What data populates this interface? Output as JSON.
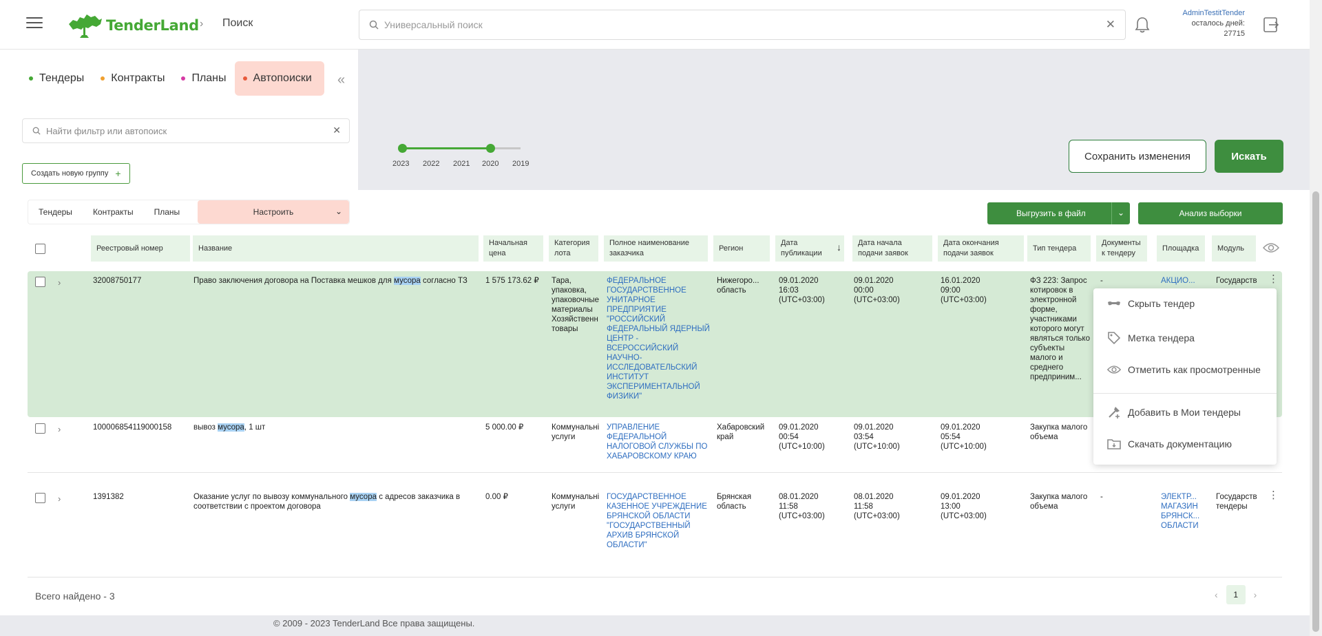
{
  "header": {
    "logo_text": "TenderLand",
    "breadcrumb": "Поиск",
    "search_placeholder": "Универсальный поиск",
    "user_name": "AdminTestitTender",
    "days_left_label": "осталось дней:",
    "days_left_value": "27715"
  },
  "left_panel": {
    "tabs": [
      {
        "label": "Тендеры",
        "dot_color": "#45a835"
      },
      {
        "label": "Контракты",
        "dot_color": "#f0a030"
      },
      {
        "label": "Планы",
        "dot_color": "#d63aa5"
      },
      {
        "label": "Автопоиски",
        "dot_color": "#e85a3c",
        "active": true
      }
    ],
    "filter_search_placeholder": "Найти фильтр или автопоиск",
    "new_group_label": "Создать новую группу"
  },
  "year_slider": {
    "years": [
      "2023",
      "2022",
      "2021",
      "2020",
      "2019"
    ],
    "selected_range": [
      "2023",
      "2020"
    ]
  },
  "actions": {
    "save_label": "Сохранить изменения",
    "search_label": "Искать"
  },
  "results": {
    "subtabs": [
      "Тендеры",
      "Контракты",
      "Планы"
    ],
    "configure_label": "Настроить",
    "export_label": "Выгрузить в файл",
    "analysis_label": "Анализ выборки",
    "columns": [
      "Реестровый номер",
      "Название",
      "Начальная цена",
      "Категория лота",
      "Полное наименование заказчика",
      "Регион",
      "Дата публикации",
      "Дата начала подачи заявок",
      "Дата окончания подачи заявок",
      "Тип тендера",
      "Документы к тендеру",
      "Площадка",
      "Модуль"
    ],
    "rows": [
      {
        "reg": "32008750177",
        "name_pre": "Право заключения договора на Поставка мешков для ",
        "name_hl": "мусора",
        "name_post": " согласно ТЗ",
        "price": "1 575 173.62 ₽",
        "category": "Тара, упаковка, упаковочные материалы Хозяйственн товары",
        "customer": "ФЕДЕРАЛЬНОЕ ГОСУДАРСТВЕННОЕ УНИТАРНОЕ ПРЕДПРИЯТИЕ \"РОССИЙСКИЙ ФЕДЕРАЛЬНЫЙ ЯДЕРНЫЙ ЦЕНТР - ВСЕРОССИЙСКИЙ НАУЧНО-ИССЛЕДОВАТЕЛЬСКИЙ ИНСТИТУТ ЭКСПЕРИМЕНТАЛЬНОЙ ФИЗИКИ\"",
        "region": "Нижегоро... область",
        "pub": "09.01.2020 16:03 (UTC+03:00)",
        "start": "09.01.2020 00:00 (UTC+03:00)",
        "end": "16.01.2020 09:00 (UTC+03:00)",
        "type": "ФЗ 223: Запрос котировок в электронной форме, участниками которого могут являться только субъекты малого и среднего предприним...",
        "docs": "-",
        "platform": "АКЦИО...",
        "module": "Государств"
      },
      {
        "reg": "100006854119000158",
        "name_pre": "вывоз ",
        "name_hl": "мусора",
        "name_post": ", 1 шт",
        "price": "5 000.00 ₽",
        "category": "Коммунальні услуги",
        "customer": "УПРАВЛЕНИЕ ФЕДЕРАЛЬНОЙ НАЛОГОВОЙ СЛУЖБЫ ПО ХАБАРОВСКОМУ КРАЮ",
        "region": "Хабаровский край",
        "pub": "09.01.2020 00:54 (UTC+10:00)",
        "start": "09.01.2020 03:54 (UTC+10:00)",
        "end": "09.01.2020 05:54 (UTC+10:00)",
        "type": "Закупка малого объема",
        "docs": "",
        "platform": "",
        "module": ""
      },
      {
        "reg": "1391382",
        "name_pre": "Оказание услуг по вывозу коммунального ",
        "name_hl": "мусора",
        "name_post": " с адресов заказчика в соответствии с проектом договора",
        "price": "0.00 ₽",
        "category": "Коммунальні услуги",
        "customer": "ГОСУДАРСТВЕННОЕ КАЗЕННОЕ УЧРЕЖДЕНИЕ БРЯНСКОЙ ОБЛАСТИ \"ГОСУДАРСТВЕННЫЙ АРХИВ БРЯНСКОЙ ОБЛАСТИ\"",
        "region": "Брянская область",
        "pub": "08.01.2020 11:58 (UTC+03:00)",
        "start": "08.01.2020 11:58 (UTC+03:00)",
        "end": "09.01.2020 13:00 (UTC+03:00)",
        "type": "Закупка малого объема",
        "docs": "-",
        "platform": "ЭЛЕКТР... МАГАЗИН БРЯНСК... ОБЛАСТИ",
        "module": "Государств тендеры"
      }
    ],
    "total_label": "Всего найдено - 3",
    "page": "1"
  },
  "context_menu": {
    "items": [
      {
        "label": "Скрыть тендер",
        "icon": "hide-icon"
      },
      {
        "label": "Метка тендера",
        "icon": "tag-icon"
      },
      {
        "label": "Отметить как просмотренные",
        "icon": "eye-icon"
      },
      {
        "label": "Добавить в Мои тендеры",
        "icon": "add-icon"
      },
      {
        "label": "Скачать документацию",
        "icon": "folder-icon"
      }
    ]
  },
  "footer": "© 2009 - 2023 TenderLand Все права защищены.",
  "colors": {
    "brand_green": "#45a835",
    "button_green": "#3e8e3f",
    "header_green_bg": "#e7f4e7",
    "highlight_row": "#d5ead5",
    "active_tab_bg": "#fdd9d1",
    "link_blue": "#2f6ec0"
  }
}
